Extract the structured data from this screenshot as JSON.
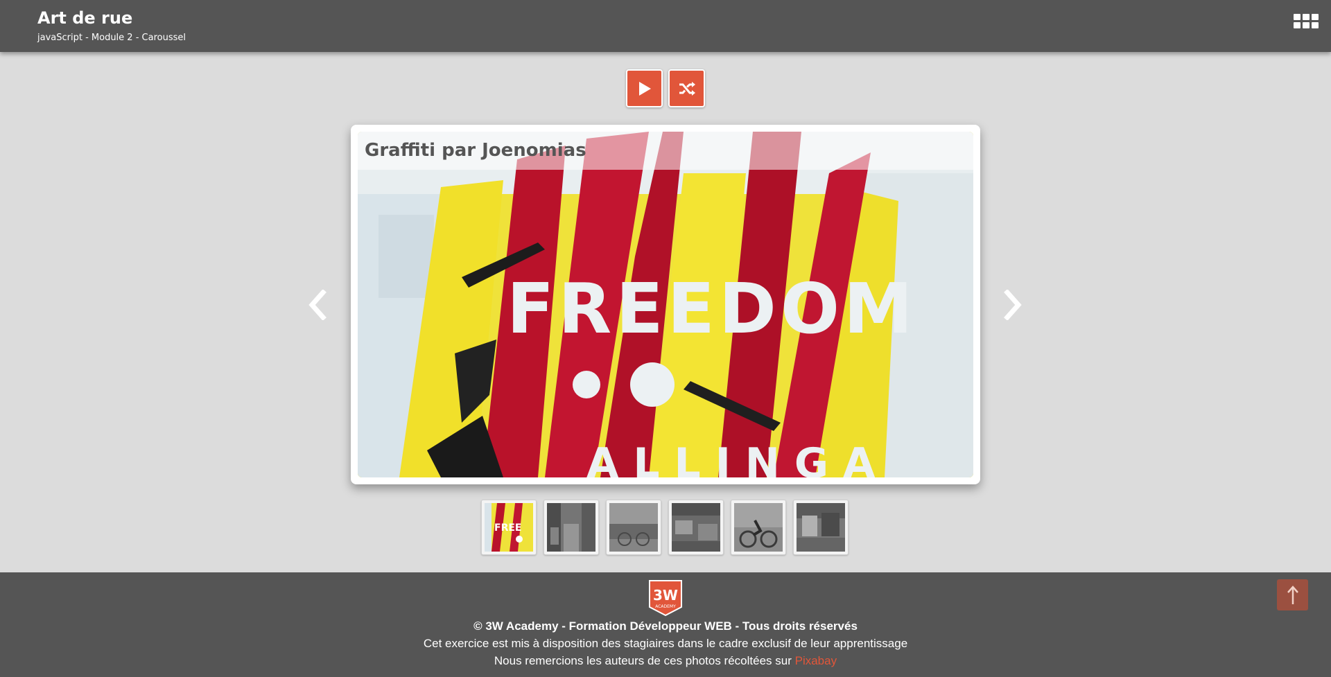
{
  "header": {
    "title": "Art de rue",
    "subtitle": "javaScript - Module 2 - Caroussel",
    "menu_icon": "grid-icon"
  },
  "toolbar": {
    "play_icon": "play-icon",
    "shuffle_icon": "shuffle-icon",
    "accent_color": "#e1563a"
  },
  "slider": {
    "caption": "Graffiti par Joenomias",
    "prev_icon": "chevron-left-icon",
    "next_icon": "chevron-right-icon",
    "slide_text": "FREEDOM",
    "active_index": 0,
    "thumbnail_count": 6
  },
  "footer": {
    "logo_text": "3W",
    "logo_subtext": "ACADEMY",
    "copyright": "© 3W Academy - Formation Développeur WEB - Tous droits réservés",
    "notice": "Cet exercice est mis à disposition des stagiaires dans le cadre exclusif de leur apprentissage",
    "credits_prefix": "Nous remercions les auteurs de ces photos récoltées sur ",
    "credits_link": "Pixabay",
    "to_top_icon": "arrow-up-icon"
  },
  "colors": {
    "header_bg": "#555555",
    "page_bg": "#dcdcdc",
    "accent": "#e1563a"
  }
}
